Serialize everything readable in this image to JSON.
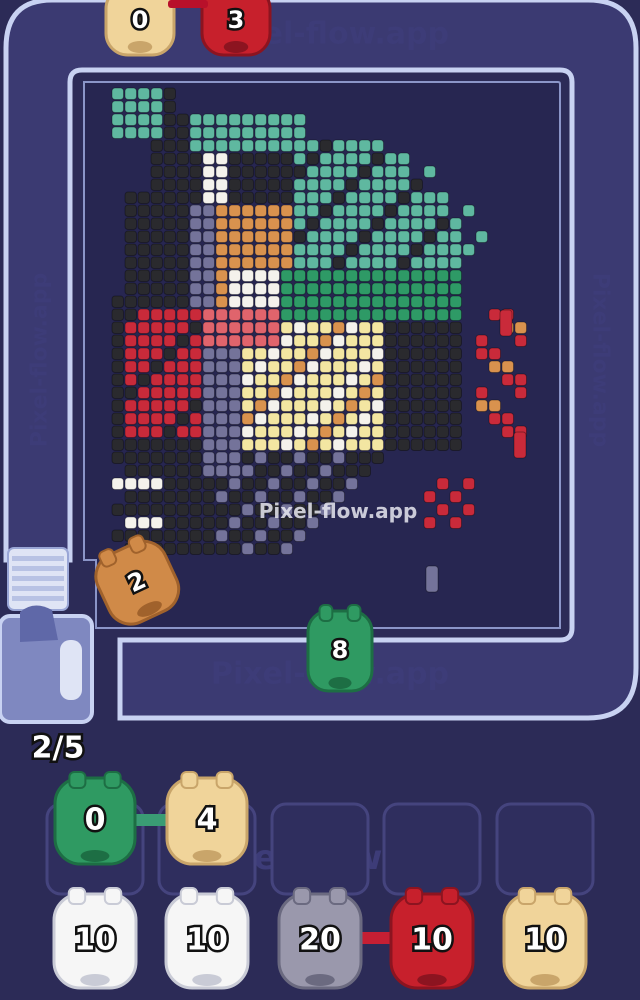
{
  "watermark": "Pixel-flow.app",
  "conveyor": {
    "capacity_text": "2/5",
    "filled": 2,
    "total": 5
  },
  "belt_pigs": [
    {
      "color": "cream",
      "count": "0"
    },
    {
      "color": "red",
      "count": "3"
    },
    {
      "color": "orange",
      "count": "2"
    },
    {
      "color": "green",
      "count": "8"
    }
  ],
  "slots": [
    {
      "state": "filled",
      "color": "green",
      "count": "0"
    },
    {
      "state": "filled",
      "color": "cream",
      "count": "4"
    },
    {
      "state": "empty"
    },
    {
      "state": "empty"
    },
    {
      "state": "empty"
    }
  ],
  "queue": [
    {
      "color": "white",
      "count": "10"
    },
    {
      "color": "white",
      "count": "10"
    },
    {
      "color": "gray",
      "count": "20"
    },
    {
      "color": "red",
      "count": "10"
    },
    {
      "color": "cream",
      "count": "10"
    }
  ],
  "colors": {
    "background": "#2c2b57",
    "board": "#272651",
    "belt": "#c8d2f2",
    "teal": "#5fb8a0",
    "green": "#2e9a66",
    "dark": "#2a2a2e",
    "gray": "#74739a",
    "white": "#f4f2ec",
    "tan": "#d9924e",
    "yellow": "#f3e6a2",
    "red": "#c92a3a"
  }
}
